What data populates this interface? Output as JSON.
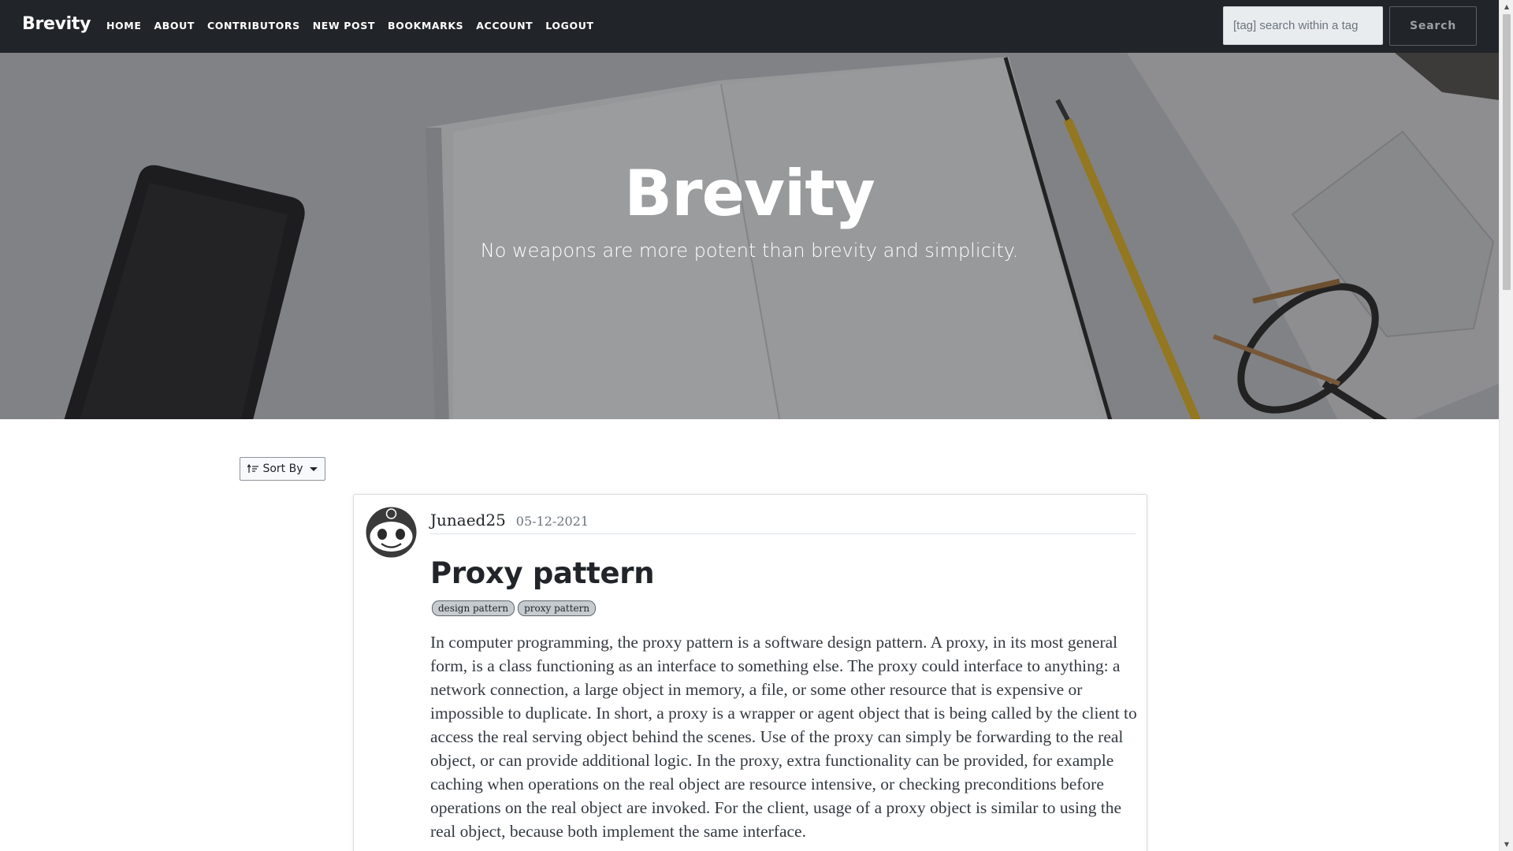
{
  "navbar": {
    "brand": "Brevity",
    "links": [
      "HOME",
      "ABOUT",
      "CONTRIBUTORS",
      "NEW POST",
      "BOOKMARKS",
      "ACCOUNT",
      "LOGOUT"
    ],
    "search_placeholder": "[tag] search within a tag",
    "search_label": "Search"
  },
  "hero": {
    "title": "Brevity",
    "subtitle": "No weapons are more potent than brevity and simplicity."
  },
  "sort": {
    "label": "Sort By",
    "icon": "sort-icon"
  },
  "post": {
    "author": "Junaed25",
    "date": "05-12-2021",
    "title": "Proxy pattern",
    "tags": [
      "design pattern",
      "proxy pattern"
    ],
    "body": "In computer programming, the proxy pattern is a software design pattern. A proxy, in its most general form, is a class functioning as an interface to something else. The proxy could interface to anything: a network connection, a large object in memory, a file, or some other resource that is expensive or impossible to duplicate. In short, a proxy is a wrapper or agent object that is being called by the client to access the real serving object behind the scenes. Use of the proxy can simply be forwarding to the real object, or can provide additional logic. In the proxy, extra functionality can be provided, for example caching when operations on the real object are resource intensive, or checking preconditions before operations on the real object are invoked. For the client, usage of a proxy object is similar to using the real object, because both implement the same interface."
  }
}
